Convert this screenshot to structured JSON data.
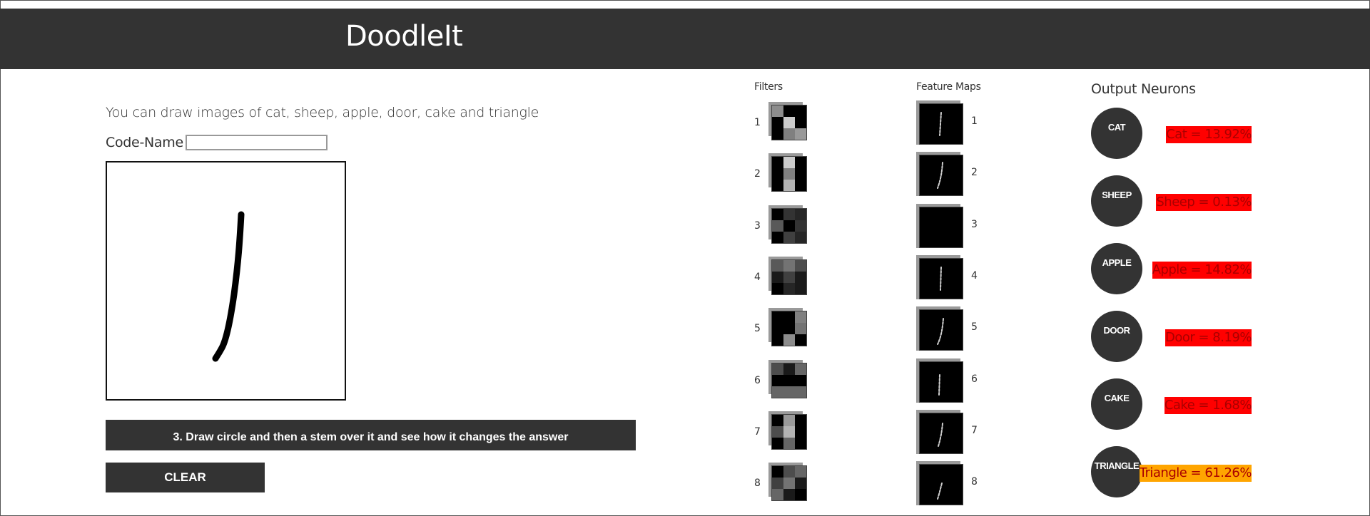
{
  "app": {
    "title": "DoodleIt"
  },
  "intro": {
    "instructions": "You can draw images of cat, sheep, apple, door, cake and triangle"
  },
  "codename": {
    "label": "Code-Name :",
    "value": "",
    "placeholder": ""
  },
  "banner": {
    "text": "3. Draw circle and then a stem over it and see how it changes the answer"
  },
  "clear_button": {
    "label": "CLEAR"
  },
  "filters": {
    "title": "Filters",
    "items": [
      {
        "index": "1",
        "cells": [
          0.55,
          0,
          0,
          0,
          0.8,
          0,
          0,
          0.5,
          0.6
        ]
      },
      {
        "index": "2",
        "cells": [
          0,
          0.8,
          0,
          0,
          0.5,
          0,
          0,
          0.7,
          0
        ]
      },
      {
        "index": "3",
        "cells": [
          0,
          0.2,
          0.15,
          0.35,
          0,
          0.2,
          0,
          0.25,
          0.15
        ]
      },
      {
        "index": "4",
        "cells": [
          0.35,
          0.45,
          0.3,
          0.1,
          0.25,
          0.1,
          0,
          0.15,
          0.1
        ]
      },
      {
        "index": "5",
        "cells": [
          0,
          0,
          0.5,
          0,
          0,
          0.45,
          0,
          0.55,
          0
        ]
      },
      {
        "index": "6",
        "cells": [
          0.3,
          0.1,
          0.4,
          0,
          0,
          0,
          0.4,
          0.4,
          0.4
        ]
      },
      {
        "index": "7",
        "cells": [
          0,
          0.6,
          0,
          0.3,
          0.7,
          0,
          0,
          0.4,
          0
        ]
      },
      {
        "index": "8",
        "cells": [
          0,
          0.3,
          0.4,
          0.25,
          0.45,
          0.1,
          0.4,
          0.1,
          0
        ]
      }
    ]
  },
  "feature_maps": {
    "title": "Feature Maps",
    "items": [
      {
        "index": "1"
      },
      {
        "index": "2"
      },
      {
        "index": "3"
      },
      {
        "index": "4"
      },
      {
        "index": "5"
      },
      {
        "index": "6"
      },
      {
        "index": "7"
      },
      {
        "index": "8"
      }
    ]
  },
  "outputs": {
    "title": "Output Neurons",
    "items": [
      {
        "name": "CAT",
        "label": "Cat = 13.92%",
        "value": 13.92,
        "highlight": "#ff0000"
      },
      {
        "name": "SHEEP",
        "label": "Sheep = 0.13%",
        "value": 0.13,
        "highlight": "#ff0000"
      },
      {
        "name": "APPLE",
        "label": "Apple = 14.82%",
        "value": 14.82,
        "highlight": "#ff0000"
      },
      {
        "name": "DOOR",
        "label": "Door = 8.19%",
        "value": 8.19,
        "highlight": "#ff0000"
      },
      {
        "name": "CAKE",
        "label": "Cake = 1.68%",
        "value": 1.68,
        "highlight": "#ff0000"
      },
      {
        "name": "TRIANGLE",
        "label": "Triangle = 61.26%",
        "value": 61.26,
        "highlight": "#ffa500"
      }
    ]
  },
  "colors": {
    "header_bg": "#333333",
    "score_low": "#ff0000",
    "score_top": "#ffa500"
  }
}
